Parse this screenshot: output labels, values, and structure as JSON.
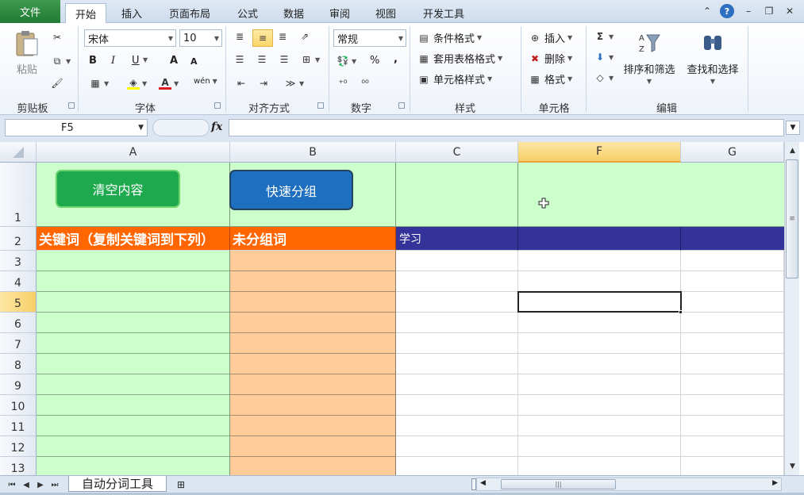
{
  "ribbon_tabs": {
    "file": "文件",
    "home": "开始",
    "insert": "插入",
    "page_layout": "页面布局",
    "formulas": "公式",
    "data": "数据",
    "review": "审阅",
    "view": "视图",
    "developer": "开发工具"
  },
  "clipboard": {
    "paste": "粘贴",
    "group": "剪贴板"
  },
  "font": {
    "name": "宋体",
    "size": "10",
    "bold": "B",
    "italic": "I",
    "underline": "U",
    "grow": "A",
    "shrink": "A",
    "wen": "wén",
    "group": "字体"
  },
  "alignment": {
    "group": "对齐方式"
  },
  "number": {
    "format": "常规",
    "percent": "%",
    "comma": ",",
    "group": "数字"
  },
  "styles": {
    "conditional": "条件格式",
    "table": "套用表格格式",
    "cell": "单元格样式",
    "group": "样式"
  },
  "cells": {
    "insert": "插入",
    "delete": "删除",
    "format": "格式",
    "group": "单元格"
  },
  "editing": {
    "sort_filter": "排序和筛选",
    "find_select": "查找和选择",
    "group": "编辑"
  },
  "formula_bar": {
    "name_box": "F5",
    "fx": "fx",
    "value": ""
  },
  "columns": [
    "A",
    "B",
    "C",
    "F",
    "G"
  ],
  "rows": [
    "1",
    "2",
    "3",
    "4",
    "5",
    "6",
    "7",
    "8",
    "9",
    "10",
    "11",
    "12",
    "13"
  ],
  "sheet": {
    "clear_button": "清空内容",
    "group_button": "快速分组",
    "a2": "关键词（复制关键词到下列）",
    "b2": "未分组词",
    "c2": "学习"
  },
  "sheet_tab": "自动分词工具",
  "colors": {
    "green_fill": "#ccffcc",
    "peach_fill": "#ffcc99",
    "orange_header": "#ff6600",
    "navy_header": "#333399",
    "clear_button": "#1fa94f",
    "group_button": "#1e6fbf"
  }
}
